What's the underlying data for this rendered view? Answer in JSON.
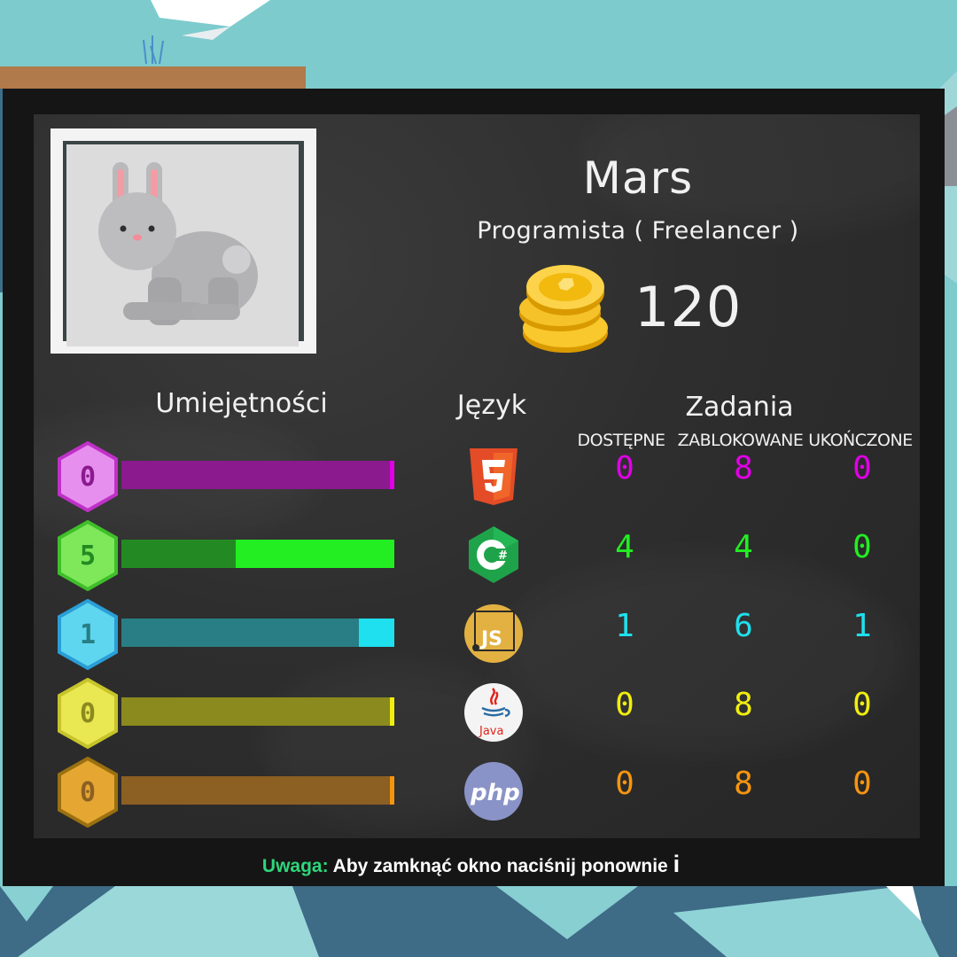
{
  "player": {
    "name": "Mars",
    "role": "Programista ( Freelancer )",
    "coins": "120",
    "avatar": "rabbit"
  },
  "headers": {
    "skills": "Umiejętności",
    "language": "Język",
    "tasks": "Zadania",
    "available": "DOSTĘPNE",
    "blocked": "ZABLOKOWANE",
    "completed": "UKOŃCZONE"
  },
  "skills": [
    {
      "language": "HTML5",
      "icon": "html5-icon",
      "level": "0",
      "progress": 0.0,
      "color": "#e000e6",
      "track": "#8a1a8e",
      "hex_fill": "#e78fef",
      "hex_border": "#c030c8",
      "available": "0",
      "blocked": "8",
      "completed": "0"
    },
    {
      "language": "C#",
      "icon": "csharp-icon",
      "level": "5",
      "progress": 0.58,
      "color": "#22ee22",
      "track": "#238a23",
      "hex_fill": "#7fe85a",
      "hex_border": "#3fbf2a",
      "available": "4",
      "blocked": "4",
      "completed": "0"
    },
    {
      "language": "JavaScript",
      "icon": "javascript-icon",
      "level": "1",
      "progress": 0.13,
      "color": "#1fe0ee",
      "track": "#287e84",
      "hex_fill": "#5fd6ef",
      "hex_border": "#2a9ed6",
      "available": "1",
      "blocked": "6",
      "completed": "1"
    },
    {
      "language": "Java",
      "icon": "java-icon",
      "level": "0",
      "progress": 0.0,
      "color": "#f0ee10",
      "track": "#8a8a1e",
      "hex_fill": "#e9e752",
      "hex_border": "#c6c42a",
      "available": "0",
      "blocked": "8",
      "completed": "0"
    },
    {
      "language": "PHP",
      "icon": "php-icon",
      "level": "0",
      "progress": 0.0,
      "color": "#f5950f",
      "track": "#8c5f22",
      "hex_fill": "#e5a732",
      "hex_border": "#9a7010",
      "available": "0",
      "blocked": "8",
      "completed": "0"
    }
  ],
  "footer": {
    "warning_label": "Uwaga:",
    "message": "Aby zamknąć okno naciśnij ponownie",
    "key": "i"
  }
}
